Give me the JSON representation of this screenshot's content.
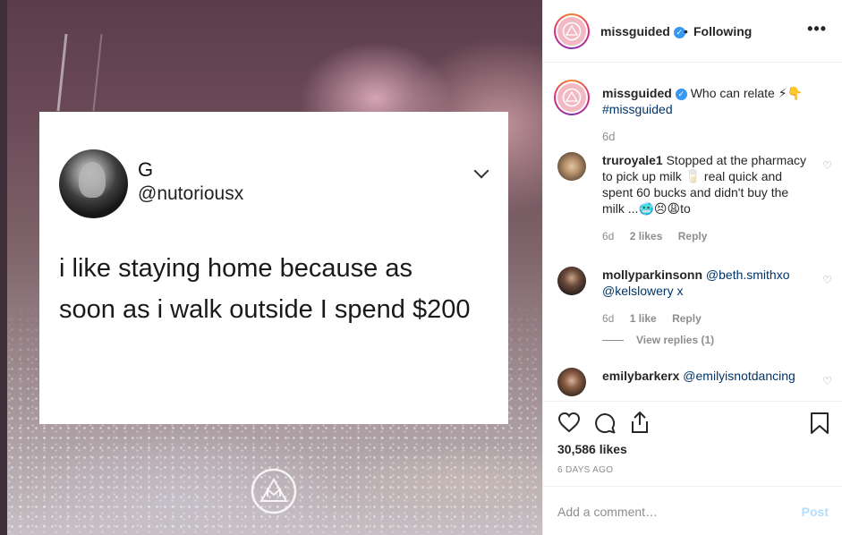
{
  "media": {
    "tweet": {
      "name": "G",
      "handle": "@nutoriousx",
      "text": "i like staying home because as soon as i walk outside I spend $200"
    }
  },
  "header": {
    "username": "missguided",
    "separator": "•",
    "follow_status": "Following",
    "more_label": "•••"
  },
  "caption": {
    "username": "missguided",
    "text": "Who can relate ⚡👇",
    "hashtag": "#missguided",
    "time": "6d"
  },
  "comments": [
    {
      "username": "truroyale1",
      "text": "Stopped at the pharmacy to pick up milk 🥛 real quick and spent 60 bucks and didn't buy the milk ...🥶😣😩to",
      "time": "6d",
      "likes": "2 likes",
      "reply": "Reply"
    },
    {
      "username": "mollyparkinsonn",
      "mention1": "@beth.smithxo",
      "mention2": "@kelslowery x",
      "time": "6d",
      "likes": "1 like",
      "reply": "Reply",
      "view_replies": "View replies (1)"
    },
    {
      "username": "emilybarkerx",
      "mention1": "@emilyisnotdancing"
    }
  ],
  "post": {
    "likes": "30,586 likes",
    "age": "6 DAYS AGO"
  },
  "add_comment": {
    "placeholder": "Add a comment…",
    "post_label": "Post"
  },
  "icons": {
    "heart": "heart-icon",
    "comment": "comment-icon",
    "share": "share-icon",
    "bookmark": "bookmark-icon",
    "verified": "verified-badge-icon",
    "more": "more-options-icon"
  },
  "colors": {
    "verified": "#3897f0",
    "link": "#003569",
    "muted": "#8e8e8e",
    "post_disabled": "#b2dffc"
  }
}
